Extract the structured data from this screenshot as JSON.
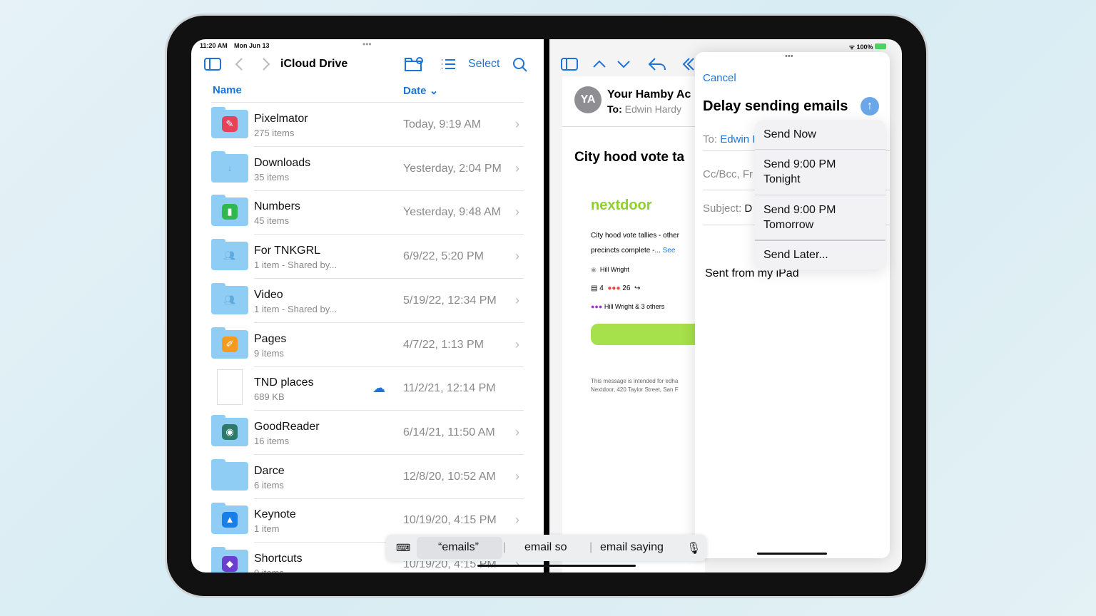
{
  "files": {
    "status_time": "11:20 AM",
    "status_date": "Mon Jun 13",
    "title": "iCloud Drive",
    "select_label": "Select",
    "col_name": "Name",
    "col_date": "Date",
    "rows": [
      {
        "name": "Pixelmator",
        "sub": "275 items",
        "date": "Today, 9:19 AM",
        "icon": "pixelmator-icon",
        "color": "#e8425a"
      },
      {
        "name": "Downloads",
        "sub": "35 items",
        "date": "Yesterday, 2:04 PM",
        "icon": "download-icon",
        "color": "#8fcdf5"
      },
      {
        "name": "Numbers",
        "sub": "45 items",
        "date": "Yesterday, 9:48 AM",
        "icon": "numbers-icon",
        "color": "#2fb84e"
      },
      {
        "name": "For TNKGRL",
        "sub": "1 item - Shared by...",
        "date": "6/9/22, 5:20 PM",
        "icon": "shared-icon",
        "color": "#8fcdf5"
      },
      {
        "name": "Video",
        "sub": "1 item - Shared by...",
        "date": "5/19/22, 12:34 PM",
        "icon": "shared-icon",
        "color": "#8fcdf5"
      },
      {
        "name": "Pages",
        "sub": "9 items",
        "date": "4/7/22, 1:13 PM",
        "icon": "pages-icon",
        "color": "#f39a1f"
      },
      {
        "name": "TND places",
        "sub": "689 KB",
        "date": "11/2/21, 12:14 PM",
        "icon": "document-icon",
        "color": "#ffffff"
      },
      {
        "name": "GoodReader",
        "sub": "16 items",
        "date": "6/14/21, 11:50 AM",
        "icon": "goodreader-icon",
        "color": "#2d7a6a"
      },
      {
        "name": "Darce",
        "sub": "6 items",
        "date": "12/8/20, 10:52 AM",
        "icon": "folder-icon",
        "color": "#8fcdf5"
      },
      {
        "name": "Keynote",
        "sub": "1 item",
        "date": "10/19/20, 4:15 PM",
        "icon": "keynote-icon",
        "color": "#1a7ee8"
      },
      {
        "name": "Shortcuts",
        "sub": "0 items",
        "date": "10/19/20, 4:15 PM",
        "icon": "shortcuts-icon",
        "color": "#6a3fd0"
      }
    ]
  },
  "mail": {
    "battery": "100%",
    "avatar": "YA",
    "sender": "Your Hamby Ac",
    "to_label": "To:",
    "to_name": "Edwin Hardy",
    "subject": "City hood vote ta",
    "brand": "nextdoor",
    "snippet1": "City hood vote tallies - other",
    "snippet2": "precincts complete -...",
    "see": "See",
    "author": "Hill Wright",
    "comments": "4",
    "reactions": "26",
    "reactors": "Hill Wright & 3 others",
    "footer1": "This message is intended for edha",
    "footer2": "Nextdoor, 420 Taylor Street, San F"
  },
  "compose": {
    "cancel": "Cancel",
    "title": "Delay sending emails",
    "to_label": "To:",
    "to_value": "Edwin I",
    "cc": "Cc/Bcc, Fr",
    "subject_label": "Subject:",
    "subject_value": "D",
    "body": "Sent from my iPad",
    "menu": [
      "Send Now",
      "Send 9:00 PM Tonight",
      "Send 9:00 PM Tomorrow",
      "Send Later..."
    ]
  },
  "keyboard": {
    "suggestions": [
      "“emails”",
      "email so",
      "email saying"
    ]
  }
}
